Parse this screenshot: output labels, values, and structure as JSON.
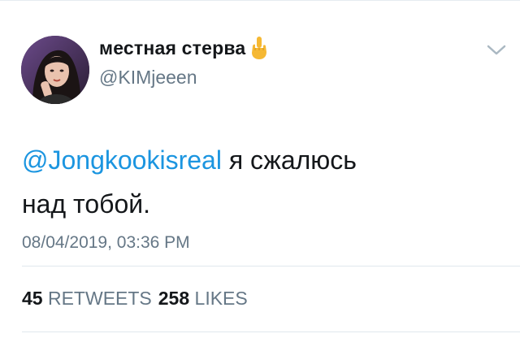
{
  "user": {
    "display_name": "местная стерва",
    "handle": "@KIMjeeen"
  },
  "tweet": {
    "mention": "@Jongkookisreal",
    "text_line1_rest": " я сжалюсь",
    "text_line2": "над тобой.",
    "timestamp": "08/04/2019, 03:36 PM"
  },
  "stats": {
    "retweets_count": "45",
    "retweets_label": " RETWEETS",
    "likes_count": "258",
    "likes_label": " LIKES"
  },
  "icons": {
    "emoji": "middle-finger-emoji",
    "menu": "chevron-down-icon"
  },
  "colors": {
    "mention": "#1b95e0",
    "secondary_text": "#657786",
    "primary_text": "#14171a"
  }
}
